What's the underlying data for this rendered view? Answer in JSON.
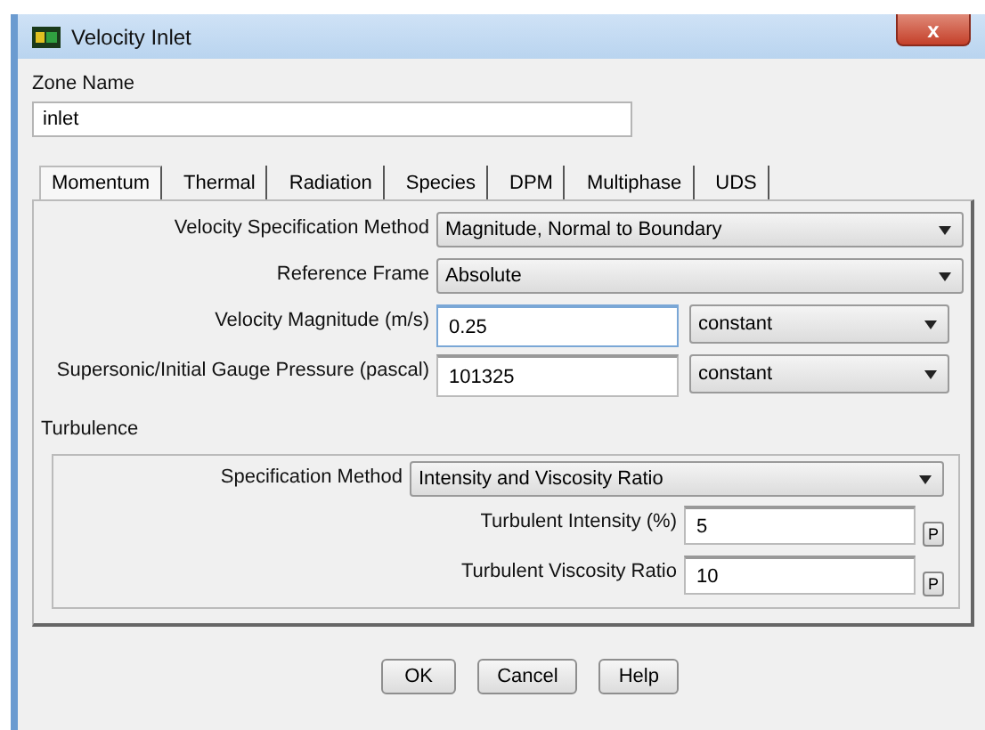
{
  "window": {
    "title": "Velocity Inlet",
    "close": "x"
  },
  "zone_name": {
    "label": "Zone Name",
    "value": "inlet"
  },
  "tabs": [
    {
      "label": "Momentum",
      "selected": true
    },
    {
      "label": "Thermal",
      "selected": false
    },
    {
      "label": "Radiation",
      "selected": false
    },
    {
      "label": "Species",
      "selected": false
    },
    {
      "label": "DPM",
      "selected": false
    },
    {
      "label": "Multiphase",
      "selected": false
    },
    {
      "label": "UDS",
      "selected": false
    }
  ],
  "fields": [
    {
      "kind": "dropdown",
      "label": "Velocity Specification Method",
      "value": "Magnitude, Normal to Boundary"
    },
    {
      "kind": "dropdown",
      "label": "Reference Frame",
      "value": "Absolute"
    },
    {
      "kind": "input",
      "label": "Velocity Magnitude (m/s)",
      "value": "0.25",
      "option": "constant",
      "focused": true
    },
    {
      "kind": "input",
      "label": "Supersonic/Initial Gauge Pressure (pascal)",
      "value": "101325",
      "option": "constant",
      "focused": false
    }
  ],
  "turbulence": {
    "title": "Turbulence",
    "fields": [
      {
        "kind": "dropdown",
        "label": "Specification Method",
        "value": "Intensity and Viscosity Ratio"
      },
      {
        "kind": "param",
        "label": "Turbulent Intensity (%)",
        "value": "5",
        "button": "P"
      },
      {
        "kind": "param",
        "label": "Turbulent Viscosity Ratio",
        "value": "10",
        "button": "P"
      }
    ]
  },
  "buttons": [
    "OK",
    "Cancel",
    "Help"
  ]
}
